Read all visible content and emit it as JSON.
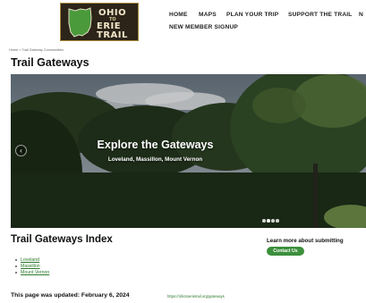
{
  "logo": {
    "word1": "OHIO",
    "word2": "TO",
    "word3": "ERIE",
    "word4": "TRAIL",
    "colors": {
      "background": "#2c2418",
      "state": "#4a9a3c",
      "text": "#f3e7c9"
    }
  },
  "nav": {
    "home": "HOME",
    "maps": "MAPS",
    "plan": "PLAN YOUR TRIP",
    "support": "SUPPORT THE TRAIL",
    "overflow": "N",
    "signup": "NEW MEMBER SIGNUP"
  },
  "breadcrumb": {
    "home": "Home",
    "separator": ">",
    "current": "Trail Gateway Communities"
  },
  "page_title": "Trail Gateways",
  "hero": {
    "heading": "Explore the Gateways",
    "subheading": "Loveland, Massillon, Mount Vernon",
    "prev_icon": "chevron-left-icon",
    "slide_count": 4,
    "active_slide": 1
  },
  "index": {
    "title": "Trail Gateways Index",
    "items": [
      "Loveland",
      "Massillon",
      "Mount Vernon"
    ]
  },
  "sidebar": {
    "learn_more": "Learn more about submitting",
    "contact_button": "Contact Us"
  },
  "footer": {
    "updated_label": "This page was updated: February 6, 2024",
    "url": "https://ohiotoerietrail.org/gateways"
  },
  "colors": {
    "accent_green": "#3c8f3c",
    "link_green": "#2c7a2c"
  }
}
